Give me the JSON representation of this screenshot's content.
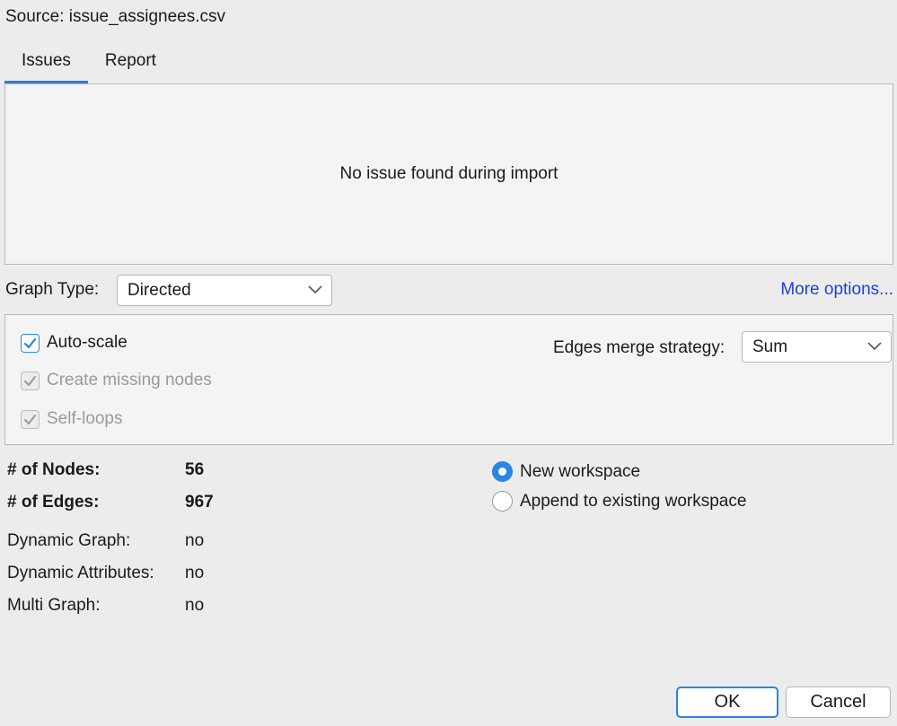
{
  "source": "Source:  issue_assignees.csv",
  "tabs": [
    {
      "label": "Issues",
      "active": true
    },
    {
      "label": "Report",
      "active": false
    }
  ],
  "issues_message": "No issue found during import",
  "graph_type": {
    "label": "Graph Type:",
    "value": "Directed"
  },
  "more_options": "More options...",
  "options": {
    "auto_scale": {
      "label": "Auto-scale",
      "checked": true,
      "enabled": true
    },
    "create_missing_nodes": {
      "label": "Create missing nodes",
      "checked": true,
      "enabled": false
    },
    "self_loops": {
      "label": "Self-loops",
      "checked": true,
      "enabled": false
    },
    "edges_merge_strategy": {
      "label": "Edges merge strategy:",
      "value": "Sum"
    }
  },
  "stats": {
    "nodes_label": "# of Nodes:",
    "nodes_value": "56",
    "edges_label": "# of Edges:",
    "edges_value": "967",
    "dynamic_graph_label": "Dynamic Graph:",
    "dynamic_graph_value": "no",
    "dynamic_attributes_label": "Dynamic Attributes:",
    "dynamic_attributes_value": "no",
    "multi_graph_label": "Multi Graph:",
    "multi_graph_value": "no"
  },
  "workspace": {
    "new_label": "New workspace",
    "append_label": "Append to existing workspace",
    "selected": "new"
  },
  "buttons": {
    "ok": "OK",
    "cancel": "Cancel"
  },
  "colors": {
    "accent": "#2a86e0",
    "link": "#1d3fe0"
  }
}
